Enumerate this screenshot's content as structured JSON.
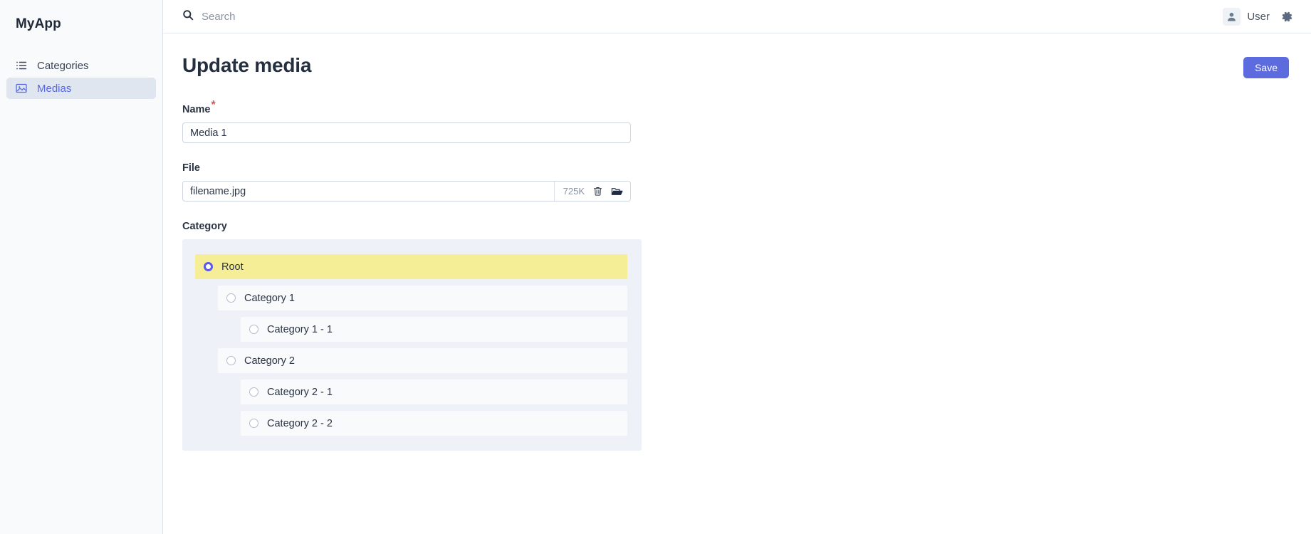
{
  "sidebar": {
    "brand": "MyApp",
    "items": [
      {
        "label": "Categories",
        "icon": "list-icon",
        "active": false
      },
      {
        "label": "Medias",
        "icon": "image-icon",
        "active": true
      }
    ]
  },
  "topbar": {
    "search_placeholder": "Search",
    "user_label": "User",
    "avatar_icon": "user-icon",
    "settings_icon": "gear-icon",
    "search_icon": "search-icon"
  },
  "page": {
    "title": "Update media",
    "save_label": "Save"
  },
  "form": {
    "name": {
      "label": "Name",
      "required_marker": "*",
      "value": "Media 1",
      "placeholder": "Name"
    },
    "file": {
      "label": "File",
      "filename": "filename.jpg",
      "size": "725K",
      "delete_icon": "trash-icon",
      "browse_icon": "folder-open-icon"
    },
    "category": {
      "label": "Category",
      "items": [
        {
          "label": "Root",
          "level": 0,
          "selected": true
        },
        {
          "label": "Category 1",
          "level": 1,
          "selected": false
        },
        {
          "label": "Category 1 - 1",
          "level": 2,
          "selected": false
        },
        {
          "label": "Category 2",
          "level": 1,
          "selected": false
        },
        {
          "label": "Category 2 - 1",
          "level": 2,
          "selected": false
        },
        {
          "label": "Category 2 - 2",
          "level": 2,
          "selected": false
        }
      ]
    }
  },
  "colors": {
    "accent": "#5c6bdd",
    "selected_row": "#f5ee97",
    "sidebar_bg": "#f8fafc",
    "tree_bg": "#eef2f8",
    "required": "#e05252"
  }
}
